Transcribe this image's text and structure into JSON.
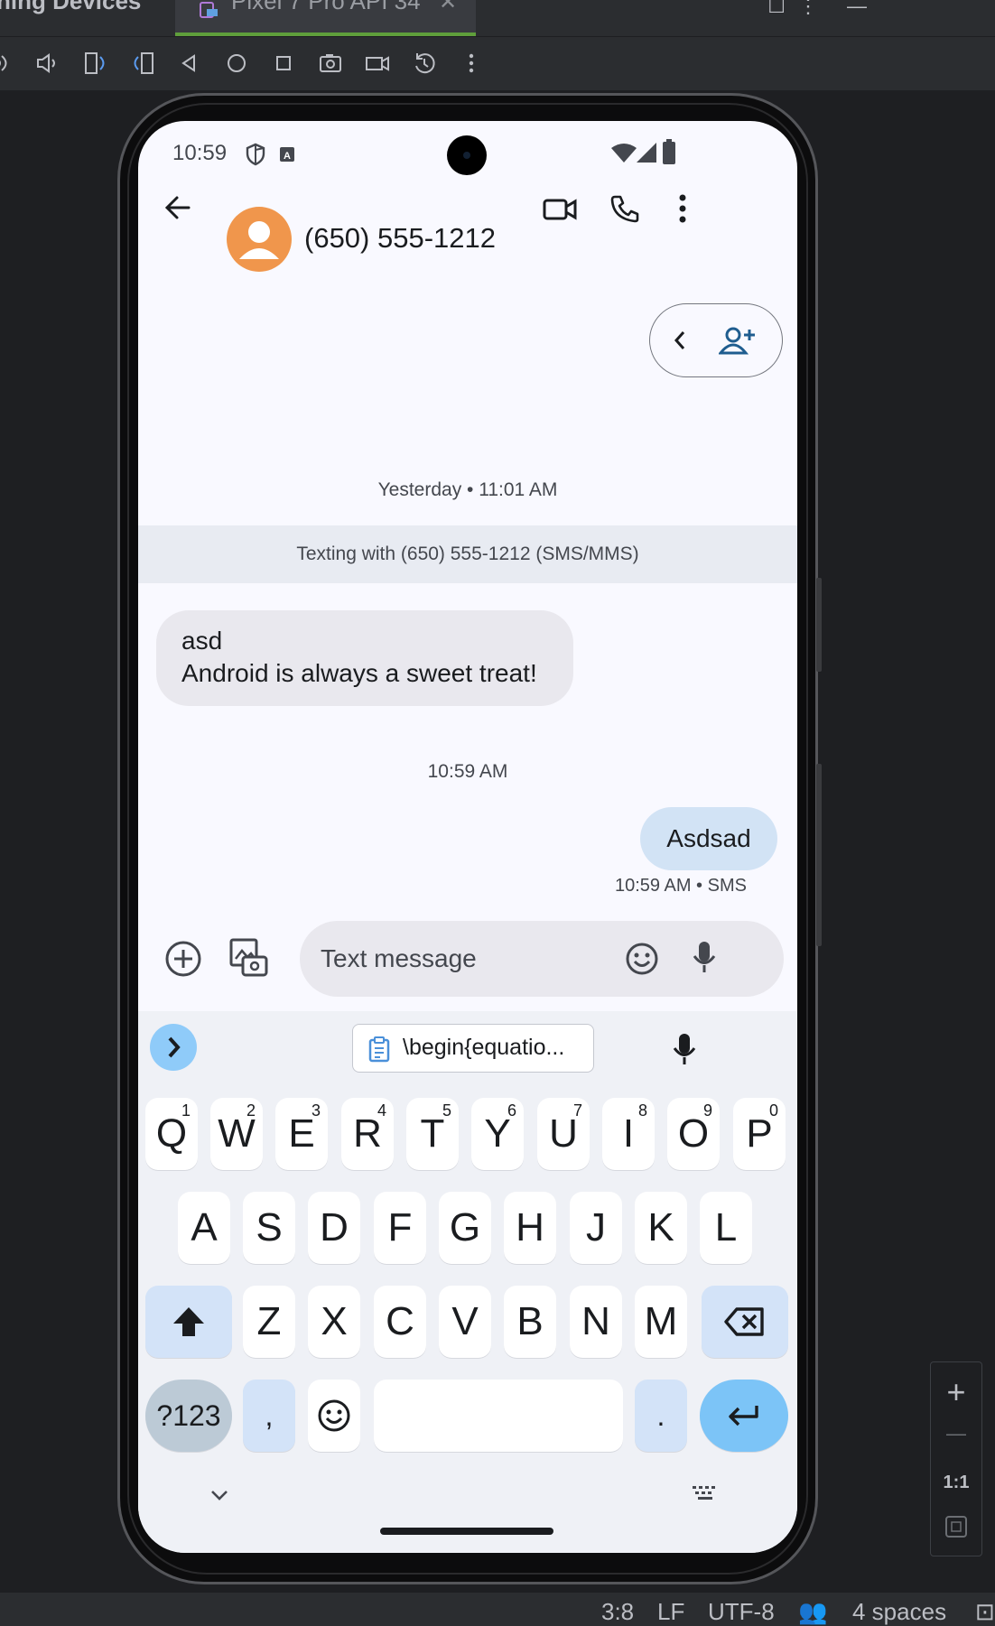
{
  "ide": {
    "tool_window_title": "ning Devices",
    "device_tab_label": "Pixel 7 Pro API 34",
    "toolbar_icons": [
      "volume-up-icon",
      "volume-down-icon",
      "rotate-left-icon",
      "rotate-right-icon",
      "back-icon",
      "home-icon",
      "overview-icon",
      "screenshot-icon",
      "screen-record-icon",
      "snapshot-icon",
      "more-icon"
    ],
    "zoom": {
      "plus": "+",
      "minus": "—",
      "actual": "1:1"
    },
    "status": {
      "position": "3:8",
      "line_ending": "LF",
      "encoding": "UTF-8",
      "indent": "4 spaces"
    }
  },
  "phone": {
    "status_bar": {
      "time": "10:59"
    },
    "conversation": {
      "contact": "(650) 555-1212",
      "yesterday_separator": "Yesterday • 11:01 AM",
      "texting_banner": "Texting with (650) 555-1212 (SMS/MMS)",
      "incoming": {
        "line1": "asd",
        "line2": "Android is always a sweet treat!"
      },
      "today_separator": "10:59 AM",
      "outgoing": {
        "text": "Asdsad",
        "meta": "10:59 AM • SMS"
      }
    },
    "compose": {
      "placeholder": "Text message"
    },
    "keyboard": {
      "suggestion": "\\begin{equatio...",
      "row1": [
        {
          "k": "Q",
          "h": "1"
        },
        {
          "k": "W",
          "h": "2"
        },
        {
          "k": "E",
          "h": "3"
        },
        {
          "k": "R",
          "h": "4"
        },
        {
          "k": "T",
          "h": "5"
        },
        {
          "k": "Y",
          "h": "6"
        },
        {
          "k": "U",
          "h": "7"
        },
        {
          "k": "I",
          "h": "8"
        },
        {
          "k": "O",
          "h": "9"
        },
        {
          "k": "P",
          "h": "0"
        }
      ],
      "row2": [
        "A",
        "S",
        "D",
        "F",
        "G",
        "H",
        "J",
        "K",
        "L"
      ],
      "row3": [
        "Z",
        "X",
        "C",
        "V",
        "B",
        "N",
        "M"
      ],
      "symbols_key": "?123",
      "comma_key": ",",
      "period_key": "."
    }
  },
  "colors": {
    "avatar": "#f0964c",
    "outgoing_bubble": "#d2e3f5",
    "enter_key": "#7cc4f7",
    "tab_underline": "#5f9f3b"
  }
}
